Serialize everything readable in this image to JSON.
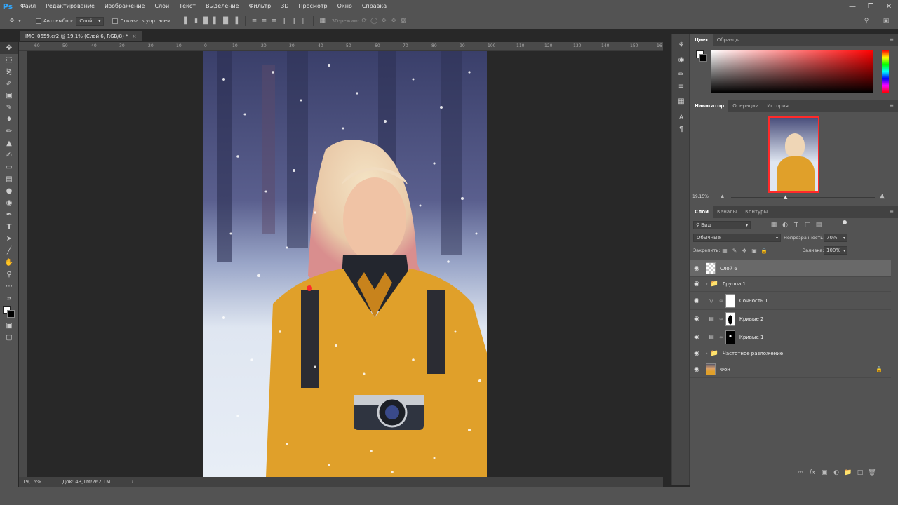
{
  "app": {
    "logo": "Ps"
  },
  "menu": [
    "Файл",
    "Редактирование",
    "Изображение",
    "Слои",
    "Текст",
    "Выделение",
    "Фильтр",
    "3D",
    "Просмотр",
    "Окно",
    "Справка"
  ],
  "options": {
    "autoselect_label": "Автовыбор:",
    "autoselect_value": "Слой",
    "show_controls_label": "Показать упр. элем.",
    "mode3d_label": "3D-режим:"
  },
  "document": {
    "tab_title": "IMG_0659.cr2 @ 19,1% (Слой 6, RGB/8) *"
  },
  "ruler": {
    "h_ticks": [
      "60",
      "50",
      "40",
      "30",
      "20",
      "10",
      "0",
      "10",
      "20",
      "30",
      "40",
      "50",
      "60",
      "70",
      "80",
      "90",
      "100",
      "110",
      "120",
      "130",
      "140",
      "150",
      "16"
    ]
  },
  "status": {
    "zoom": "19,15%",
    "doc": "Док: 43,1M/262,1M"
  },
  "color_panel": {
    "tabs": [
      "Цвет",
      "Образцы"
    ]
  },
  "navigator_panel": {
    "tabs": [
      "Навигатор",
      "Операции",
      "История"
    ],
    "zoom": "19,15%"
  },
  "layers_panel": {
    "tabs": [
      "Слои",
      "Каналы",
      "Контуры"
    ],
    "filter_label": "Вид",
    "blend_mode": "Обычные",
    "opacity_label": "Непрозрачность:",
    "opacity_value": "70%",
    "lock_label": "Закрепить:",
    "fill_label": "Заливка:",
    "fill_value": "100%",
    "layers": [
      {
        "name": "Слой 6",
        "kind": "pixel",
        "selected": true
      },
      {
        "name": "Группа 1",
        "kind": "group"
      },
      {
        "name": "Сочность 1",
        "kind": "adjustment-vibrance"
      },
      {
        "name": "Кривые 2",
        "kind": "adjustment-curves"
      },
      {
        "name": "Кривые 1",
        "kind": "adjustment-curves"
      },
      {
        "name": "Частотное разложение",
        "kind": "group"
      },
      {
        "name": "Фон",
        "kind": "background",
        "locked": true
      }
    ]
  },
  "colors": {
    "accent_red": "#ff0000",
    "panel_bg": "#535353",
    "jacket": "#e0a02a"
  }
}
